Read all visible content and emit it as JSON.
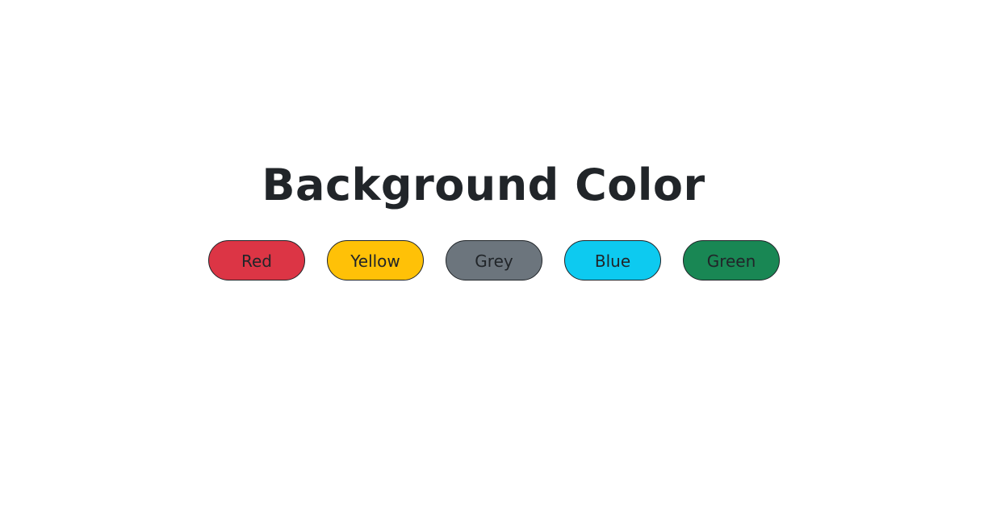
{
  "heading": "Background Color",
  "buttons": [
    {
      "label": "Red",
      "color": "#dc3545"
    },
    {
      "label": "Yellow",
      "color": "#ffc107"
    },
    {
      "label": "Grey",
      "color": "#6c757d"
    },
    {
      "label": "Blue",
      "color": "#0dcaf0"
    },
    {
      "label": "Green",
      "color": "#198754"
    }
  ]
}
